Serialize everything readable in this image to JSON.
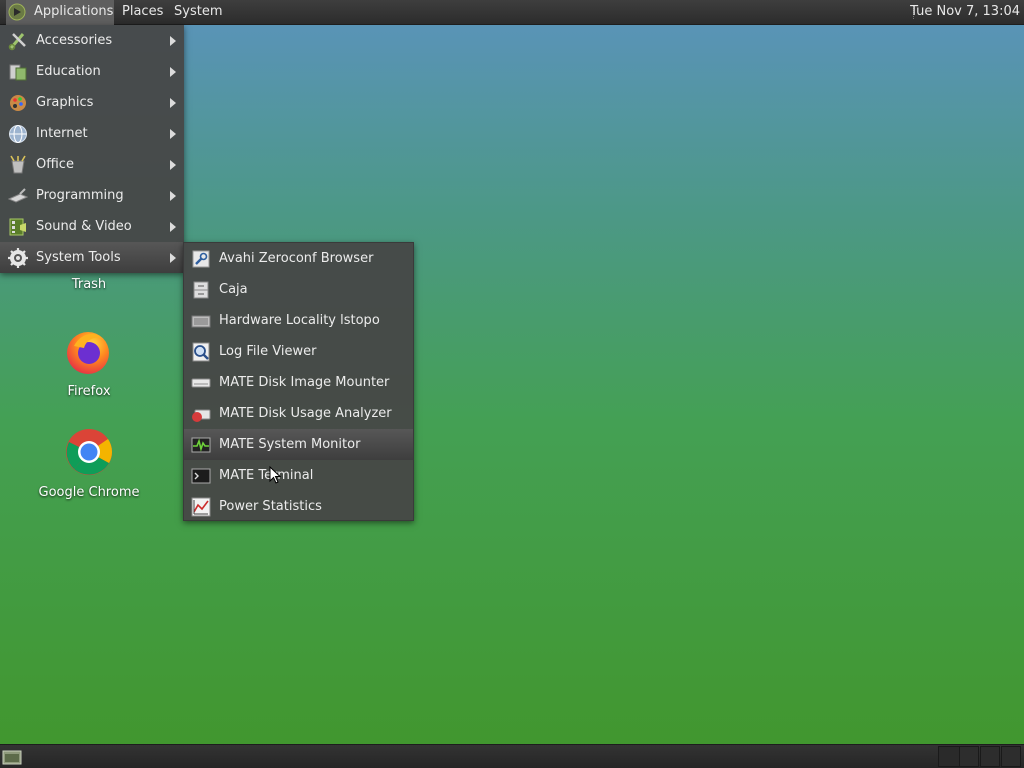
{
  "top_panel": {
    "applications_label": "Applications",
    "places_label": "Places",
    "system_label": "System",
    "clock": "Tue Nov 7, 13:04"
  },
  "desktop_icons": [
    {
      "label": "Trash",
      "icon": "trash-icon"
    },
    {
      "label": "Firefox",
      "icon": "firefox-icon"
    },
    {
      "label": "Google Chrome",
      "icon": "chrome-icon"
    }
  ],
  "applications_menu": {
    "items": [
      {
        "label": "Accessories",
        "icon": "accessories-icon"
      },
      {
        "label": "Education",
        "icon": "education-icon"
      },
      {
        "label": "Graphics",
        "icon": "graphics-icon"
      },
      {
        "label": "Internet",
        "icon": "internet-icon"
      },
      {
        "label": "Office",
        "icon": "office-icon"
      },
      {
        "label": "Programming",
        "icon": "programming-icon"
      },
      {
        "label": "Sound & Video",
        "icon": "sound-video-icon"
      },
      {
        "label": "System Tools",
        "icon": "system-tools-icon",
        "highlighted": true
      }
    ]
  },
  "system_tools_menu": {
    "items": [
      {
        "label": "Avahi Zeroconf Browser",
        "icon": "avahi-icon"
      },
      {
        "label": "Caja",
        "icon": "caja-icon"
      },
      {
        "label": "Hardware Locality lstopo",
        "icon": "hardware-icon"
      },
      {
        "label": "Log File Viewer",
        "icon": "log-viewer-icon"
      },
      {
        "label": "MATE Disk Image Mounter",
        "icon": "disk-mounter-icon"
      },
      {
        "label": "MATE Disk Usage Analyzer",
        "icon": "disk-usage-icon"
      },
      {
        "label": "MATE System Monitor",
        "icon": "system-monitor-icon",
        "highlighted": true
      },
      {
        "label": "MATE Terminal",
        "icon": "terminal-icon"
      },
      {
        "label": "Power Statistics",
        "icon": "power-statistics-icon"
      }
    ]
  },
  "colors": {
    "panel": "#2c2c2c",
    "menu_bg": "#464646",
    "highlight": "#575757",
    "desktop_top": "#5b93bd",
    "desktop_bottom": "#41962c"
  }
}
